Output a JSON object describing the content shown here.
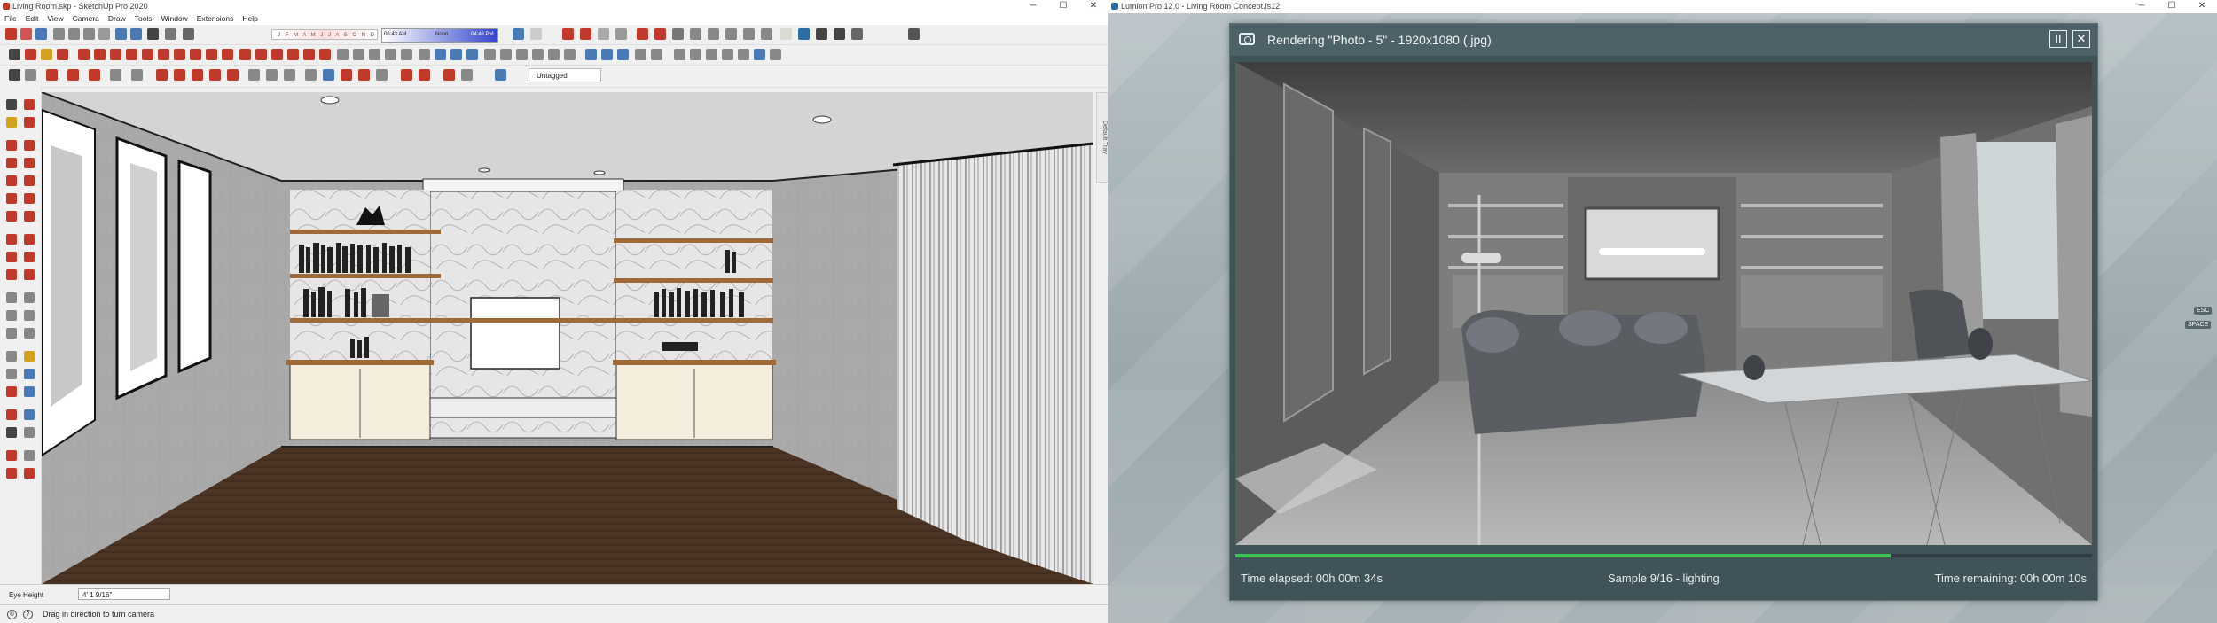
{
  "sketchup": {
    "window_title": "Living Room.skp - SketchUp Pro 2020",
    "menu": [
      "File",
      "Edit",
      "View",
      "Camera",
      "Draw",
      "Tools",
      "Window",
      "Extensions",
      "Help"
    ],
    "shadow_months": "J F M A M J J A S O N D",
    "shadow_time_start": "06:43 AM",
    "shadow_time_noon": "Noon",
    "shadow_time_end": "04:46 PM",
    "tag_dropdown": "Untagged",
    "scene_tab": "Default Tray",
    "measure_label": "Eye Height",
    "measure_value": "4' 1 9/16\"",
    "status_text": "Drag in direction to turn camera"
  },
  "lumion": {
    "window_title": "Lumion Pro 12.0 - Living Room Concept.ls12",
    "render_title": "Rendering \"Photo - 5\" - 1920x1080 (.jpg)",
    "pause_label": "II",
    "close_label": "✕",
    "time_elapsed": "Time elapsed: 00h 00m 34s",
    "sample": "Sample 9/16 - lighting",
    "time_remaining": "Time remaining: 00h 00m 10s",
    "progress": 0.765,
    "esc_hint": "ESC",
    "space_hint": "SPACE",
    "accent": "#3cc351"
  }
}
